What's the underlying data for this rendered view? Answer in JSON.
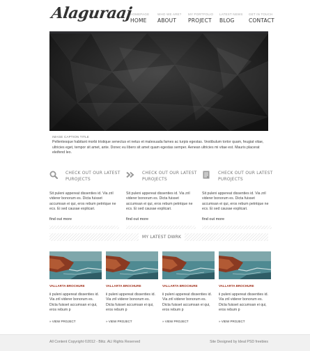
{
  "header": {
    "logo": "Alaguraaj",
    "nav": [
      {
        "sub": "HOMEPAGE",
        "label": "HOME"
      },
      {
        "sub": "WHO WE ARE?",
        "label": "ABOUT"
      },
      {
        "sub": "MY PORTFOLIO",
        "label": "PROJECT"
      },
      {
        "sub": "LATEST NEWS",
        "label": "BLOG"
      },
      {
        "sub": "GET IN TOUCH",
        "label": "CONTACT"
      }
    ]
  },
  "slider": {
    "caption_title": "IMAGE CAPTION TITLE",
    "caption_text": "Pellentesque habitant morbi tristique senectus et netus et malesuada fames ac turpis egestas. Vestibulum tortor quam, feugiat vitae, ultricies eget, tempor sit amet, ante. Donec eu libero sit amet quam egestas semper. Aenean ultricies mi vitae est. Mauris placerat eleifend leo."
  },
  "features": [
    {
      "icon": "search-icon",
      "title": "CHECK OUT OUR LATEST PUROJECTS",
      "text": "Sit puleni appereat dissenties id. Via zril viderer bonorum es. Dicta fuisset accumsan ei qui, eros rebum petntque ne ecs. Ei sed causae explicari.",
      "more": "find out more"
    },
    {
      "icon": "double-chevron-right-icon",
      "title": "CHECK OUT OUR LATEST PUROJECTS",
      "text": "Sit puleni appereat dissenties id. Via zril viderer bonorum es. Dicta fuisset accumsan ei qui, eros rebum petntque ne ecs. Ei sed causae explicari.",
      "more": "find out more"
    },
    {
      "icon": "document-icon",
      "title": "CHECK OUT OUR LATEST PUROJECTS",
      "text": "Sit puleni appereat dissenties id. Via zril viderer bonorum es. Dicta fuisset accumsan ei qui, eros rebum petntque ne ecs. Ei sed causae explicari.",
      "more": "find out more"
    }
  ],
  "work": {
    "title": "MY LATEST DWRK",
    "items": [
      {
        "title": "VALLARTA BROCHURE",
        "text": "ii puleni appereat dissenties id. Via zril viderer bonorum es. Dicta fuisset accumsan ei qui, eros rebum p",
        "more": "VIEW PROJECT"
      },
      {
        "title": "VALLARTA BROCHURE",
        "text": "ii puleni appereat dissenties id. Via zril viderer bonorum es. Dicta fuisset accumsan ei qui, eros rebum p",
        "more": "VIEW PROJECT"
      },
      {
        "title": "VALLARTA BROCHURE",
        "text": "ii puleni appereat dissenties id. Via zril viderer bonorum es. Dicta fuisset accumsan ei qui, eros rebum p",
        "more": "VIEW PROJECT"
      },
      {
        "title": "VALLARTA BROCHURE",
        "text": "ii puleni appereat dissenties id. Via zril viderer bonorum es. Dicta fuisset accumsan ei qui, eros rebum p",
        "more": "VIEW PROJECT"
      }
    ]
  },
  "footer": {
    "copyright": "All Content Copyright ©2012 - Blitz. ALl Rights Reserved",
    "credit": "Site Designed by Ideal PSD freebies"
  },
  "colors": {
    "accent": "#a3331e",
    "dark": "#2c2c30"
  }
}
